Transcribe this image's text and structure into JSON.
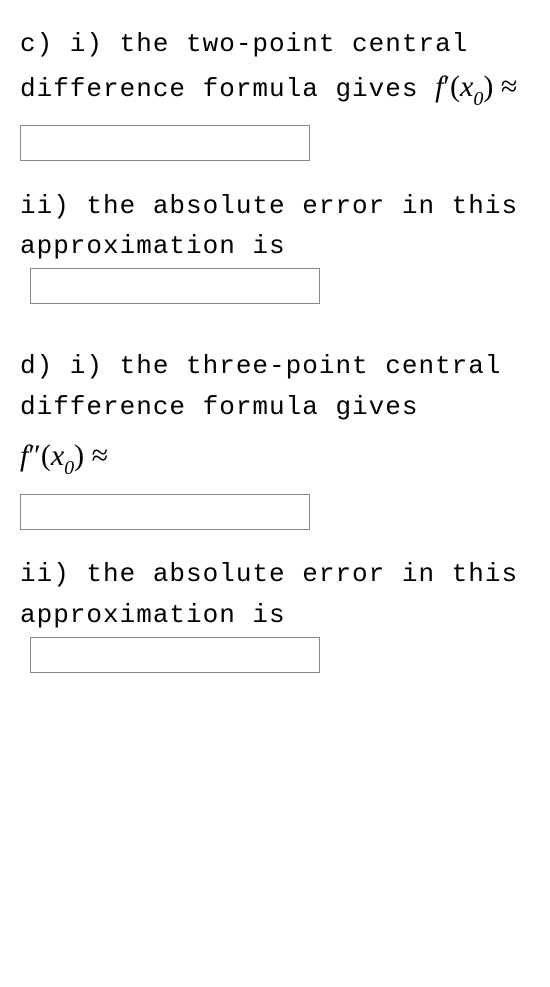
{
  "parts": {
    "c": {
      "i": {
        "text_before": "c) i) the two-point central difference formula gives ",
        "math_func": "f",
        "math_prime": "′",
        "math_arg_open": "(",
        "math_var": "x",
        "math_sub": "0",
        "math_arg_close": ")",
        "approx_symbol": " ≈"
      },
      "ii": {
        "text": "ii) the absolute error in this approximation is"
      }
    },
    "d": {
      "i": {
        "text": "d) i) the three-point central difference formula gives",
        "math_func": "f",
        "math_prime": "″",
        "math_arg_open": "(",
        "math_var": "x",
        "math_sub": "0",
        "math_arg_close": ")",
        "approx_symbol": " ≈"
      },
      "ii": {
        "text": "ii) the absolute error in this approximation is"
      }
    }
  }
}
